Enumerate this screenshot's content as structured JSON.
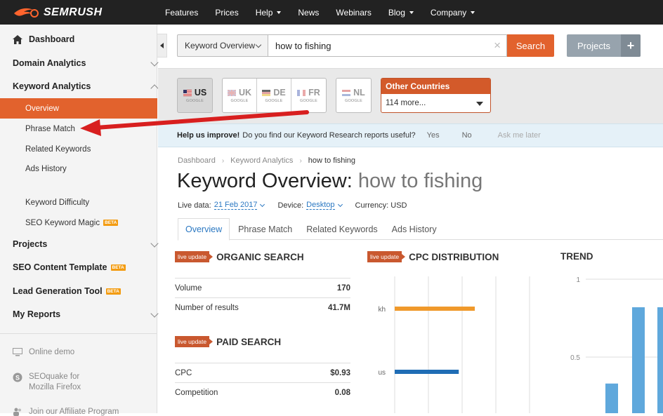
{
  "topbar": {
    "logo_text": "SEMRUSH",
    "nav": [
      {
        "label": "Features",
        "has_caret": false
      },
      {
        "label": "Prices",
        "has_caret": false
      },
      {
        "label": "Help",
        "has_caret": true
      },
      {
        "label": "News",
        "has_caret": false
      },
      {
        "label": "Webinars",
        "has_caret": false
      },
      {
        "label": "Blog",
        "has_caret": true
      },
      {
        "label": "Company",
        "has_caret": true
      }
    ]
  },
  "sidebar": {
    "dashboard": "Dashboard",
    "domain_analytics": "Domain Analytics",
    "keyword_analytics": "Keyword Analytics",
    "keyword_items": [
      {
        "label": "Overview",
        "active": true
      },
      {
        "label": "Phrase Match",
        "active": false
      },
      {
        "label": "Related Keywords",
        "active": false
      },
      {
        "label": "Ads History",
        "active": false
      }
    ],
    "keyword_difficulty": "Keyword Difficulty",
    "seo_keyword_magic": "SEO Keyword Magic",
    "beta": "BETA",
    "projects": "Projects",
    "seo_content_template": "SEO Content Template",
    "lead_generation_tool": "Lead Generation Tool",
    "my_reports": "My Reports",
    "online_demo": "Online demo",
    "seoquake_line1": "SEOquake for",
    "seoquake_line2": "Mozilla Firefox",
    "affiliate": "Join our Affiliate Program"
  },
  "search": {
    "database": "Keyword Overview",
    "query": "how to fishing",
    "search_label": "Search",
    "projects_label": "Projects",
    "plus": "+"
  },
  "countries": {
    "selected": {
      "code": "US",
      "sub": "GOOGLE"
    },
    "group": [
      {
        "code": "UK",
        "sub": "GOOGLE"
      },
      {
        "code": "DE",
        "sub": "GOOGLE"
      },
      {
        "code": "FR",
        "sub": "GOOGLE"
      }
    ],
    "single": {
      "code": "NL",
      "sub": "GOOGLE"
    },
    "other_title": "Other Countries",
    "other_value": "114 more..."
  },
  "help": {
    "bold": "Help us improve!",
    "question": "Do you find our Keyword Research reports useful?",
    "yes": "Yes",
    "no": "No",
    "later": "Ask me later"
  },
  "breadcrumb": [
    "Dashboard",
    "Keyword Analytics",
    "how to fishing"
  ],
  "title": {
    "prefix": "Keyword Overview:",
    "keyword": "how to fishing"
  },
  "meta": {
    "live_data_label": "Live data:",
    "live_data_value": "21 Feb 2017",
    "device_label": "Device:",
    "device_value": "Desktop",
    "currency": "Currency: USD"
  },
  "tabs": [
    "Overview",
    "Phrase Match",
    "Related Keywords",
    "Ads History"
  ],
  "organic": {
    "badge": "live update",
    "title": "ORGANIC SEARCH",
    "rows": [
      {
        "label": "Volume",
        "value": "170"
      },
      {
        "label": "Number of results",
        "value": "41.7M"
      }
    ]
  },
  "paid": {
    "badge": "live update",
    "title": "PAID SEARCH",
    "rows": [
      {
        "label": "CPC",
        "value": "$0.93"
      },
      {
        "label": "Competition",
        "value": "0.08"
      }
    ]
  },
  "cpc_distribution": {
    "badge": "live update",
    "title": "CPC DISTRIBUTION"
  },
  "trend": {
    "title": "TREND"
  },
  "colors": {
    "accent": "#e2622d",
    "link": "#2b78c2",
    "bar_orange": "#f0992b",
    "bar_blue": "#1f6db5",
    "trend_bar": "#5fa8dc"
  },
  "chart_data": [
    {
      "type": "bar",
      "title": "CPC DISTRIBUTION",
      "orientation": "horizontal",
      "categories": [
        "kh",
        "us"
      ],
      "values": [
        0.6,
        0.48
      ],
      "grid": true
    },
    {
      "type": "bar",
      "title": "TREND",
      "y_ticks": [
        "1",
        "0.5"
      ],
      "ylim": [
        0,
        1
      ],
      "values": [
        0.33,
        0.82,
        0.82
      ],
      "grid": true
    }
  ]
}
